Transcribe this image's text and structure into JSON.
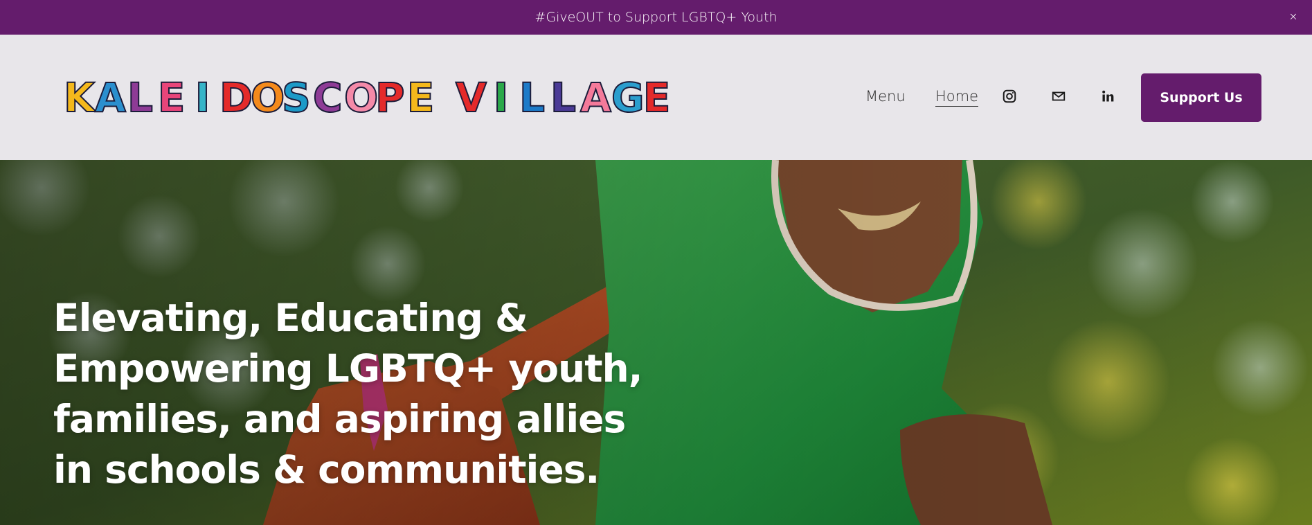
{
  "announcement": {
    "text": "#GiveOUT to Support LGBTQ+ Youth",
    "close_label": "×"
  },
  "header": {
    "logo": {
      "text": "KALEIDOSCOPE VILLAGE",
      "letters": [
        {
          "char": "K",
          "color": "#f4b81c"
        },
        {
          "char": "A",
          "color": "#2b8fce"
        },
        {
          "char": "L",
          "color": "#8e3b96"
        },
        {
          "char": "E",
          "color": "#e8457a"
        },
        {
          "char": "I",
          "color": "#36b4c8"
        },
        {
          "char": "D",
          "color": "#e42a2a"
        },
        {
          "char": "O",
          "color": "#f48a1c"
        },
        {
          "char": "S",
          "color": "#1c9ac8"
        },
        {
          "char": "C",
          "color": "#8e3b96"
        },
        {
          "char": "O",
          "color": "#f48aa8"
        },
        {
          "char": "P",
          "color": "#e42a2a"
        },
        {
          "char": "E",
          "color": "#f4b81c"
        },
        {
          "char": " ",
          "color": "#000000"
        },
        {
          "char": "V",
          "color": "#e42a2a"
        },
        {
          "char": "I",
          "color": "#2ba84a"
        },
        {
          "char": "L",
          "color": "#1c7ac8"
        },
        {
          "char": "L",
          "color": "#4a3a96"
        },
        {
          "char": "A",
          "color": "#f47a9a"
        },
        {
          "char": "G",
          "color": "#2b9ece"
        },
        {
          "char": "E",
          "color": "#e42a2a"
        }
      ]
    },
    "nav": {
      "menu_label": "Menu",
      "home_label": "Home"
    },
    "icons": [
      "instagram-icon",
      "mail-icon",
      "linkedin-icon"
    ],
    "support_button": "Support Us"
  },
  "hero": {
    "title": "Elevating, Educating & Empowering LGBTQ+ youth, families, and aspiring allies in schools & communities."
  },
  "colors": {
    "brand_purple": "#641c6c",
    "header_bg": "#e8e6ea"
  }
}
